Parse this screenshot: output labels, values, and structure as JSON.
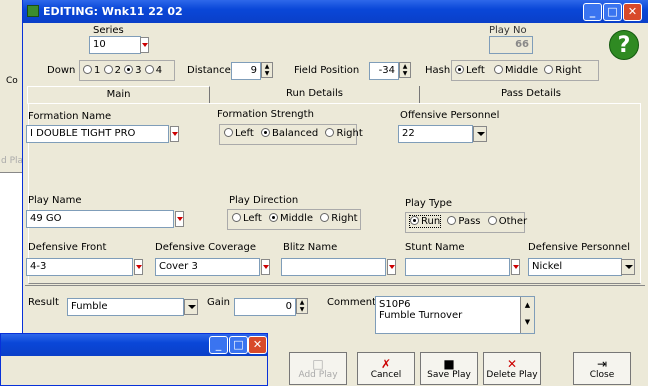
{
  "window": {
    "title": "EDITING: Wnk11 22 02"
  },
  "series": {
    "label": "Series",
    "value": "10"
  },
  "play_no": {
    "label": "Play No",
    "value": "66"
  },
  "down": {
    "label": "Down",
    "options": [
      "1",
      "2",
      "3",
      "4"
    ],
    "selected": "3"
  },
  "distance": {
    "label": "Distance",
    "value": "9"
  },
  "field_position": {
    "label": "Field Position",
    "value": "-34"
  },
  "hash": {
    "label": "Hash",
    "options": [
      "Left",
      "Middle",
      "Right"
    ],
    "selected": "Left"
  },
  "tabs": [
    "Main",
    "Run Details",
    "Pass Details"
  ],
  "formation_name": {
    "label": "Formation Name",
    "value": "I DOUBLE TIGHT PRO"
  },
  "formation_strength": {
    "label": "Formation Strength",
    "options": [
      "Left",
      "Balanced",
      "Right"
    ],
    "selected": "Balanced"
  },
  "offensive_personnel": {
    "label": "Offensive Personnel",
    "value": "22"
  },
  "play_name": {
    "label": "Play Name",
    "value": "49 GO"
  },
  "play_direction": {
    "label": "Play Direction",
    "options": [
      "Left",
      "Middle",
      "Right"
    ],
    "selected": "Middle"
  },
  "play_type": {
    "label": "Play Type",
    "options": [
      "Run",
      "Pass",
      "Other"
    ],
    "selected": "Run"
  },
  "defensive_front": {
    "label": "Defensive Front",
    "value": "4-3"
  },
  "defensive_coverage": {
    "label": "Defensive Coverage",
    "value": "Cover 3"
  },
  "blitz_name": {
    "label": "Blitz Name",
    "value": ""
  },
  "stunt_name": {
    "label": "Stunt Name",
    "value": ""
  },
  "defensive_personnel": {
    "label": "Defensive Personnel",
    "value": "Nickel"
  },
  "result": {
    "label": "Result",
    "value": "Fumble"
  },
  "gain": {
    "label": "Gain",
    "value": "0"
  },
  "comment": {
    "label": "Comment",
    "line1": "S10P6",
    "line2": "Fumble Turnover"
  },
  "buttons": {
    "add_play": "Add Play",
    "cancel": "Cancel",
    "save_play": "Save Play",
    "delete_play": "Delete Play",
    "close": "Close"
  },
  "background": {
    "co1": "Co",
    "co2": "Co",
    "add_play_ghost": "d Pla"
  }
}
